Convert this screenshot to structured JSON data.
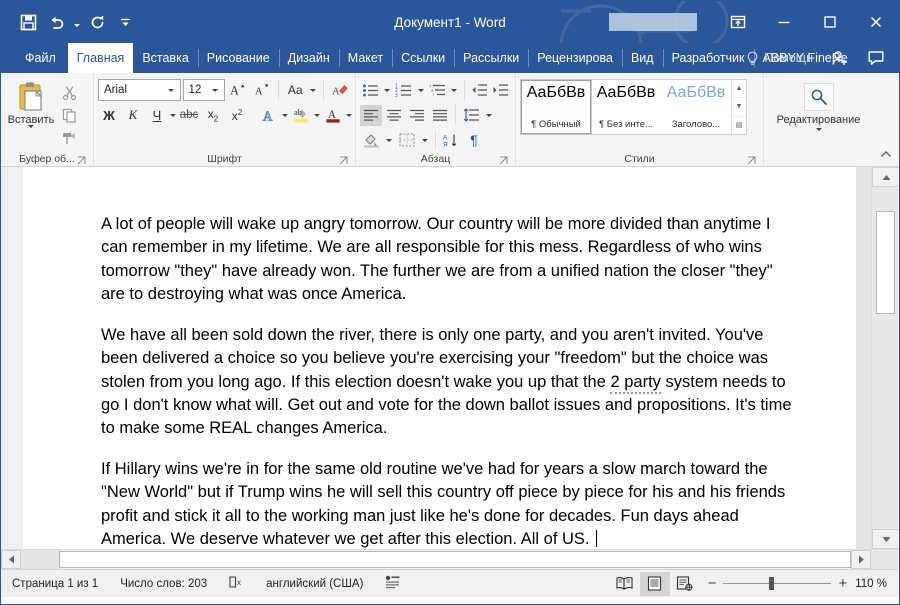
{
  "window": {
    "title": "Документ1  -  Word",
    "quick_access": [
      {
        "name": "save-icon",
        "label": "Сохранить"
      },
      {
        "name": "undo-icon",
        "label": "Отменить"
      },
      {
        "name": "redo-icon",
        "label": "Вернуть"
      },
      {
        "name": "customize-qat-icon",
        "label": "Настройка панели быстрого доступа"
      }
    ],
    "controls": [
      {
        "name": "ribbon-display-options-button",
        "glyph": "ribbon"
      },
      {
        "name": "minimize-button",
        "glyph": "minimize"
      },
      {
        "name": "maximize-button",
        "glyph": "maximize"
      },
      {
        "name": "close-button",
        "glyph": "close"
      }
    ]
  },
  "tabs": [
    {
      "label": "Файл",
      "active": false
    },
    {
      "label": "Главная",
      "active": true
    },
    {
      "label": "Вставка",
      "active": false
    },
    {
      "label": "Рисование",
      "active": false
    },
    {
      "label": "Дизайн",
      "active": false
    },
    {
      "label": "Макет",
      "active": false
    },
    {
      "label": "Ссылки",
      "active": false
    },
    {
      "label": "Рассылки",
      "active": false
    },
    {
      "label": "Рецензирова",
      "active": false
    },
    {
      "label": "Вид",
      "active": false
    },
    {
      "label": "Разработчик",
      "active": false
    },
    {
      "label": "ABBYY FineRe",
      "active": false
    }
  ],
  "tab_right": {
    "help_label": "Помощн",
    "share_label": "Общий доступ",
    "comments_label": "Примечания"
  },
  "ribbon": {
    "clipboard": {
      "label": "Буфер об...",
      "paste_label": "Вставить",
      "buttons": [
        {
          "name": "cut-icon",
          "label": "Вырезать"
        },
        {
          "name": "copy-icon",
          "label": "Копировать"
        },
        {
          "name": "format-painter-icon",
          "label": "Формат по образцу"
        }
      ]
    },
    "font": {
      "label": "Шрифт",
      "font_name": "Arial",
      "font_size": "12",
      "buttons": [
        {
          "name": "grow-font-button",
          "label": "A"
        },
        {
          "name": "shrink-font-button",
          "label": "A"
        },
        {
          "name": "change-case-button",
          "label": "Aa"
        },
        {
          "name": "clear-formatting-button",
          "label": "Очистить формат"
        },
        {
          "name": "bold-button",
          "label": "Ж"
        },
        {
          "name": "italic-button",
          "label": "К"
        },
        {
          "name": "underline-button",
          "label": "Ч"
        },
        {
          "name": "strikethrough-button",
          "label": "abc"
        },
        {
          "name": "subscript-button",
          "label": "x₂"
        },
        {
          "name": "superscript-button",
          "label": "x²"
        },
        {
          "name": "text-effects-button",
          "label": "A"
        },
        {
          "name": "text-highlight-button",
          "label": "ab"
        },
        {
          "name": "font-color-button",
          "label": "A"
        }
      ]
    },
    "paragraph": {
      "label": "Абзац",
      "buttons": [
        {
          "name": "bullets-button",
          "label": "Маркеры"
        },
        {
          "name": "numbering-button",
          "label": "Нумерация"
        },
        {
          "name": "multilevel-list-button",
          "label": "Многоуровневый список"
        },
        {
          "name": "decrease-indent-button",
          "label": "Уменьшить отступ"
        },
        {
          "name": "increase-indent-button",
          "label": "Увеличить отступ"
        },
        {
          "name": "align-left-button",
          "label": "По левому краю"
        },
        {
          "name": "align-center-button",
          "label": "По центру"
        },
        {
          "name": "align-right-button",
          "label": "По правому краю"
        },
        {
          "name": "justify-button",
          "label": "По ширине"
        },
        {
          "name": "line-spacing-button",
          "label": "Интервал"
        },
        {
          "name": "shading-button",
          "label": "Заливка"
        },
        {
          "name": "borders-button",
          "label": "Границы"
        },
        {
          "name": "sort-button",
          "label": "Сортировка"
        },
        {
          "name": "show-formatting-marks-button",
          "label": "¶"
        }
      ]
    },
    "styles": {
      "label": "Стили",
      "items": [
        {
          "preview": "АаБбВв",
          "name": "¶ Обычный",
          "selected": true,
          "blue": false
        },
        {
          "preview": "АаБбВв",
          "name": "¶ Без инте...",
          "selected": false,
          "blue": false
        },
        {
          "preview": "АаБбВв",
          "name": "Заголово...",
          "selected": false,
          "blue": true
        }
      ]
    },
    "editing": {
      "label": "Редактирование",
      "icon": "search-icon"
    }
  },
  "document": {
    "paragraphs": [
      {
        "runs": [
          {
            "text": "A lot of people will wake up angry tomorrow. Our country will be more divided than anytime I can remember in my lifetime. We are all responsible for this mess. Regardless of who wins tomorrow \"they\" have already won. The further we are from a unified nation the closer \"they\" are to destroying what was once America."
          }
        ]
      },
      {
        "runs": [
          {
            "text": "We have all been sold down the river, there is only one party, and you aren't invited. You've been delivered a choice so you believe you're exercising your \"freedom\" but the choice was stolen from you long ago. If this election doesn't wake you up that the "
          },
          {
            "text": "2 party",
            "squiggle": true
          },
          {
            "text": " system needs to go I don't know what will. Get out and vote for the down ballot issues and propositions. It's time to make some REAL changes America."
          }
        ]
      },
      {
        "runs": [
          {
            "text": "If Hillary wins we're in for the same old routine we've had for years a slow march toward the \"New World\" but if Trump wins he will sell this country off piece by piece for his and his friends profit and stick it all to the working man just like he's done for decades. Fun days ahead America. We deserve whatever we get after this election. All of US. "
          }
        ],
        "caret": true
      }
    ]
  },
  "statusbar": {
    "page_label": "Страница 1 из 1",
    "word_count_label": "Число слов: 203",
    "proofing_icon": "proofing-errors-icon",
    "language_label": "английский (США)",
    "accessibility_icon": "accessibility-icon",
    "views": [
      {
        "name": "read-mode-button",
        "active": false
      },
      {
        "name": "print-layout-button",
        "active": true
      },
      {
        "name": "web-layout-button",
        "active": false
      }
    ],
    "zoom_out_label": "−",
    "zoom_in_label": "+",
    "zoom_level": "110 %"
  },
  "colors": {
    "brand": "#2b579a",
    "ribbon_bg": "#f4f4f4",
    "doc_bg": "#f0f0f0",
    "status_bg": "#f0f0f0"
  }
}
